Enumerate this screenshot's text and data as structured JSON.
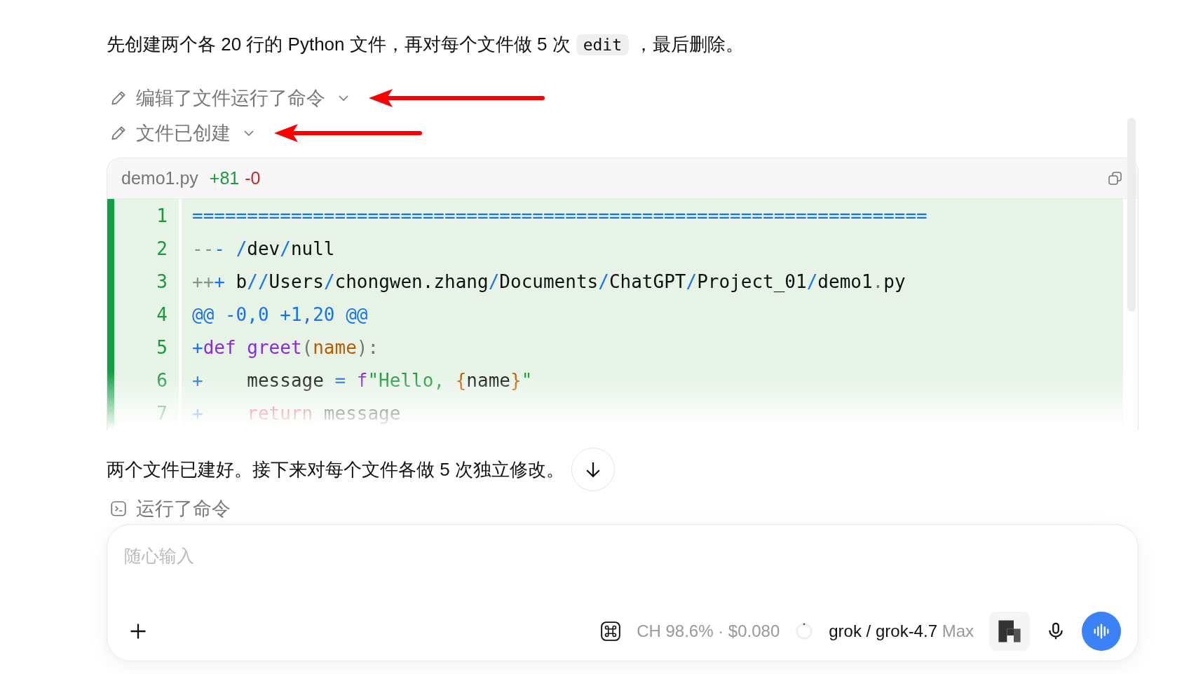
{
  "message": {
    "parts": [
      {
        "kind": "text",
        "text": "先创建两个各 20 行的 Python 文件，再对每个文件做 5 次"
      },
      {
        "kind": "code",
        "text": "edit"
      },
      {
        "kind": "text",
        "text": "，最后删除。"
      }
    ]
  },
  "actions": [
    {
      "kind": "edit",
      "label": "编辑了文件运行了命令"
    },
    {
      "kind": "edit",
      "label": "文件已创建"
    }
  ],
  "diff": {
    "filename": "demo1.py",
    "added": "+81",
    "removed": "-0",
    "lines": [
      {
        "number": "1",
        "tokens": [
          {
            "kind": "punct",
            "text": "==================================================================="
          }
        ]
      },
      {
        "number": "2",
        "tokens": [
          {
            "kind": "faint",
            "text": "--"
          },
          {
            "kind": "punct",
            "text": "- "
          },
          {
            "kind": "punct",
            "text": "/"
          },
          {
            "kind": "plain",
            "text": "dev"
          },
          {
            "kind": "punct",
            "text": "/"
          },
          {
            "kind": "plain",
            "text": "null"
          }
        ]
      },
      {
        "number": "3",
        "tokens": [
          {
            "kind": "faint",
            "text": "++"
          },
          {
            "kind": "punct",
            "text": "+"
          },
          {
            "kind": "plain",
            "text": " b"
          },
          {
            "kind": "punct",
            "text": "//"
          },
          {
            "kind": "plain",
            "text": "Users"
          },
          {
            "kind": "punct",
            "text": "/"
          },
          {
            "kind": "plain",
            "text": "chongwen.zhang"
          },
          {
            "kind": "punct",
            "text": "/"
          },
          {
            "kind": "plain",
            "text": "Documents"
          },
          {
            "kind": "punct",
            "text": "/"
          },
          {
            "kind": "plain",
            "text": "ChatGPT"
          },
          {
            "kind": "punct",
            "text": "/"
          },
          {
            "kind": "plain",
            "text": "Project_01"
          },
          {
            "kind": "punct",
            "text": "/"
          },
          {
            "kind": "plain",
            "text": "demo1"
          },
          {
            "kind": "paren",
            "text": "."
          },
          {
            "kind": "plain",
            "text": "py"
          }
        ]
      },
      {
        "number": "4",
        "tokens": [
          {
            "kind": "punct",
            "text": "@@ -0,0 +1,20 @@"
          }
        ]
      },
      {
        "number": "5",
        "tokens": [
          {
            "kind": "punct",
            "text": "+"
          },
          {
            "kind": "keyword",
            "text": "def "
          },
          {
            "kind": "keyword",
            "text": "greet"
          },
          {
            "kind": "paren",
            "text": "("
          },
          {
            "kind": "param",
            "text": "name"
          },
          {
            "kind": "paren",
            "text": "):"
          }
        ]
      },
      {
        "number": "6",
        "tokens": [
          {
            "kind": "punct",
            "text": "+"
          },
          {
            "kind": "plain",
            "text": "    message "
          },
          {
            "kind": "punct",
            "text": "= "
          },
          {
            "kind": "keyword",
            "text": "f"
          },
          {
            "kind": "string",
            "text": "\"Hello, "
          },
          {
            "kind": "param",
            "text": "{"
          },
          {
            "kind": "plain",
            "text": "name"
          },
          {
            "kind": "param",
            "text": "}"
          },
          {
            "kind": "string",
            "text": "\""
          }
        ]
      },
      {
        "number": "7",
        "tokens": [
          {
            "kind": "punct",
            "text": "+    "
          },
          {
            "kind": "control",
            "text": "return"
          },
          {
            "kind": "plain",
            "text": " message"
          }
        ]
      }
    ]
  },
  "reply": "两个文件已建好。接下来对每个文件各做 5 次独立修改。",
  "command": {
    "kind": "command",
    "label": "运行了命令"
  },
  "composer": {
    "placeholder": "随心输入",
    "usage": "CH 98.6% · $0.080",
    "model": "grok / grok-4.7",
    "tier": "Max"
  }
}
